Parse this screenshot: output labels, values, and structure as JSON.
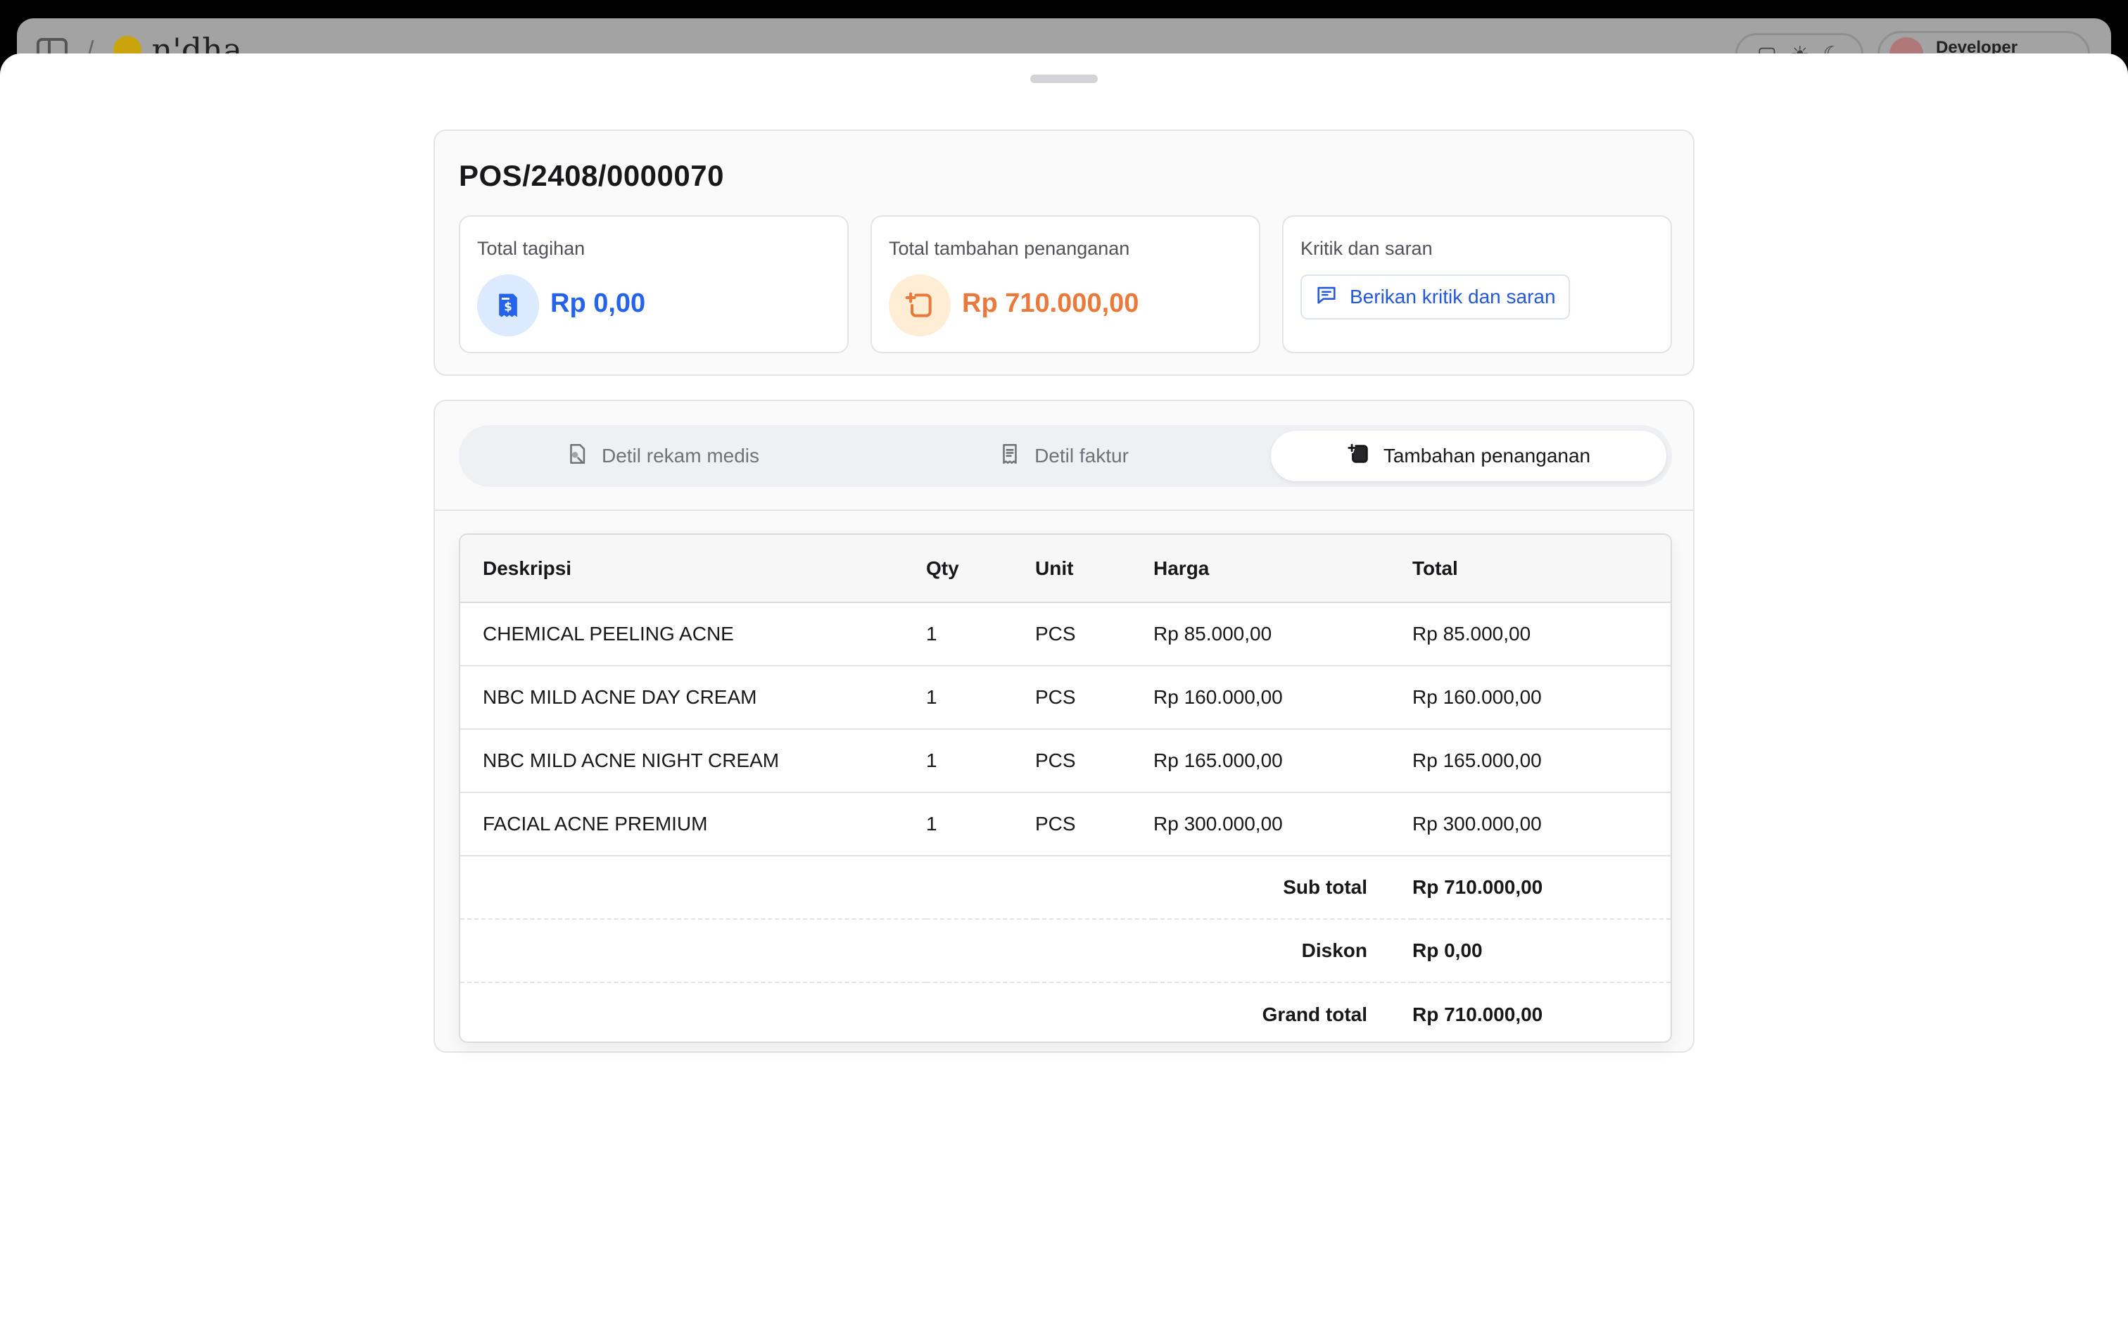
{
  "background_app": {
    "brand": "n'dha",
    "user_name": "Developer"
  },
  "invoice": {
    "number": "POS/2408/0000070"
  },
  "stats": {
    "total_bill": {
      "label": "Total tagihan",
      "value": "Rp 0,00",
      "icon": "receipt-dollar-icon",
      "color": "#2563eb"
    },
    "total_extra": {
      "label": "Total tambahan penanganan",
      "value": "Rp 710.000,00",
      "icon": "square-plus-icon",
      "color": "#ea7a3b"
    },
    "feedback": {
      "label": "Kritik dan saran",
      "button_label": "Berikan kritik dan saran",
      "icon": "message-icon"
    }
  },
  "tabs": [
    {
      "label": "Detil rekam medis",
      "icon": "medical-record-icon",
      "active": false
    },
    {
      "label": "Detil faktur",
      "icon": "invoice-icon",
      "active": false
    },
    {
      "label": "Tambahan penanganan",
      "icon": "square-plus-icon",
      "active": true
    }
  ],
  "table": {
    "headers": [
      "Deskripsi",
      "Qty",
      "Unit",
      "Harga",
      "Total"
    ],
    "rows": [
      [
        "CHEMICAL PEELING ACNE",
        "1",
        "PCS",
        "Rp 85.000,00",
        "Rp 85.000,00"
      ],
      [
        "NBC MILD ACNE DAY CREAM",
        "1",
        "PCS",
        "Rp 160.000,00",
        "Rp 160.000,00"
      ],
      [
        "NBC MILD ACNE NIGHT CREAM",
        "1",
        "PCS",
        "Rp 165.000,00",
        "Rp 165.000,00"
      ],
      [
        "FACIAL ACNE PREMIUM",
        "1",
        "PCS",
        "Rp 300.000,00",
        "Rp 300.000,00"
      ]
    ],
    "summary": [
      {
        "label": "Sub total",
        "value": "Rp 710.000,00"
      },
      {
        "label": "Diskon",
        "value": "Rp 0,00"
      },
      {
        "label": "Grand total",
        "value": "Rp 710.000,00"
      }
    ]
  }
}
